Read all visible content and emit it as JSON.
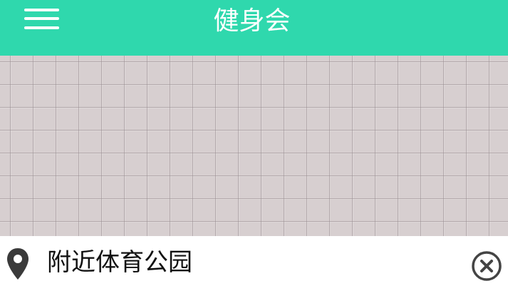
{
  "header": {
    "title": "健身会",
    "background_color": "#2fd8ad",
    "menu_icon": "hamburger-menu-icon"
  },
  "map": {
    "background_color": "#d7cfd0"
  },
  "location_bar": {
    "pin_icon": "location-pin-icon",
    "text": "附近体育公园",
    "clear_icon": "circle-close-icon"
  }
}
